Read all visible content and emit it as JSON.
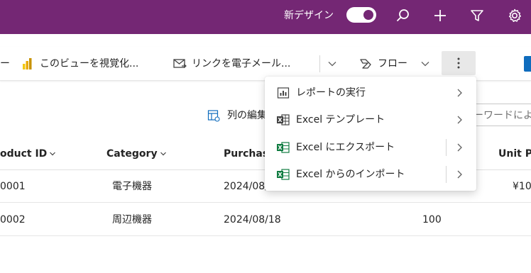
{
  "topbar": {
    "new_design_label": "新デザイン",
    "toggle_on": true,
    "icons": [
      "search-icon",
      "add-icon",
      "filter-icon",
      "settings-icon"
    ]
  },
  "commandbar": {
    "partial_left": "ー",
    "powerbi_label": "このビューを視覚化...",
    "email_link_label": "リンクを電子メール...",
    "flow_label": "フロー"
  },
  "toolbar": {
    "edit_columns_label": "列の編集",
    "search_placeholder": "ーワードによ"
  },
  "grid": {
    "headers": [
      "oduct ID",
      "Category",
      "Purchase",
      "Unit Pr"
    ],
    "rows": [
      {
        "product_id": "0001",
        "category": "電子機器",
        "purchase": "2024/08/",
        "quantity": "",
        "unit_price": "¥10"
      },
      {
        "product_id": "0002",
        "category": "周辺機器",
        "purchase": "2024/08/18",
        "quantity": "100",
        "unit_price": ""
      }
    ]
  },
  "more_menu": {
    "items": [
      {
        "label": "レポートの実行",
        "icon": "report-icon",
        "split": false
      },
      {
        "label": "Excel テンプレート",
        "icon": "excel-template-icon",
        "split": false
      },
      {
        "label": "Excel にエクスポート",
        "icon": "excel-export-icon",
        "split": true
      },
      {
        "label": "Excel からのインポート",
        "icon": "excel-import-icon",
        "split": true
      }
    ]
  },
  "colors": {
    "topbar": "#742774",
    "excel_green": "#107c41",
    "accent_blue": "#0f6cbd"
  }
}
